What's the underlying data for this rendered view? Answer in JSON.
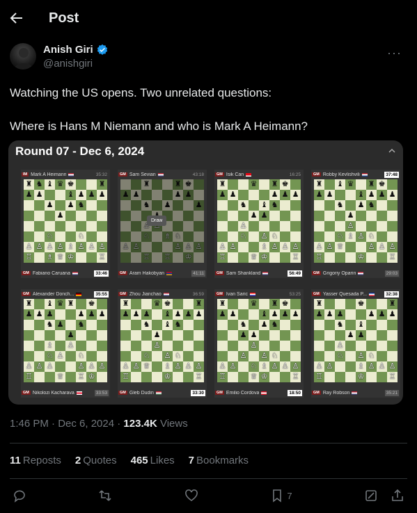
{
  "header": {
    "title": "Post"
  },
  "author": {
    "name": "Anish Giri",
    "handle": "@anishgiri"
  },
  "post": {
    "line1": "Watching the US opens. Two unrelated questions:",
    "line2": "Where is Hans M Niemann and who is Mark A Heimann?"
  },
  "media": {
    "title": "Round 07 - Dec 6, 2024",
    "draw_label": "Draw",
    "boards": [
      {
        "top": {
          "title": "IM",
          "name": "Mark A Heimann",
          "clock": "35:32",
          "flag": "us"
        },
        "bottom": {
          "title": "GM",
          "name": "Fabiano Caruana",
          "clock": "33:46",
          "flag": "us"
        },
        "fen": "rnbqk..r/pp..bppp/..p.pn../...p....//..N..N../PPPPBPPP/R.BQK..R"
      },
      {
        "top": {
          "title": "GM",
          "name": "Sam Sevian",
          "clock": "43:18",
          "flag": "us"
        },
        "bottom": {
          "title": "GM",
          "name": "Aram Hakobyan",
          "clock": "41:11",
          "flag": "am"
        },
        "fen": "..r..rk./pp...pp./..n.p..p/...p..../..PP..../..N.BN../PP...PPP/..R.R.K."
      },
      {
        "top": {
          "title": "GM",
          "name": "Isik Can",
          "clock": "16:25",
          "flag": "tr"
        },
        "bottom": {
          "title": "GM",
          "name": "Sam Shankland",
          "clock": "56:49",
          "flag": "us"
        },
        "fen": "r..q.rk./pp...ppp/..n.bn../...pp.../..P...../..N.PN../PP..BPPP/R..QK..R"
      },
      {
        "top": {
          "title": "GM",
          "name": "Robby Kevlishvili",
          "clock": "37:48",
          "flag": "nl"
        },
        "bottom": {
          "title": "GM",
          "name": "Grigoriy Oparin",
          "clock": "29:03",
          "flag": "us"
        },
        "fen": "r.bq.rk./pp..bppp/..n.pn../...p..../...P..../..NBPN../PPQ..PPP/R...K..R"
      },
      {
        "top": {
          "title": "GM",
          "name": "Alexander Donch...",
          "clock": "35:55",
          "flag": "de"
        },
        "bottom": {
          "title": "GM",
          "name": "Nikolozi Kacharava",
          "clock": "33:53",
          "flag": "ge"
        },
        "fen": "r.bqr.k./ppp..ppp/..np.n../....p.../..B.P.../..NP.N../PPP..PPP/R..Q.RK."
      },
      {
        "top": {
          "title": "GM",
          "name": "Zhou Jianchao",
          "clock": "36:59",
          "flag": "us"
        },
        "bottom": {
          "title": "GM",
          "name": "Gleb Dudin",
          "clock": "33:30",
          "flag": "hu"
        },
        "fen": "r..qk..r/ppp.bppp/..n.bn../...p..../...P..../..N.PN../PPQ.BPPP/R...K..R"
      },
      {
        "top": {
          "title": "GM",
          "name": "Ivan Saric",
          "clock": "53:25",
          "flag": "hr"
        },
        "bottom": {
          "title": "GM",
          "name": "Emilio Cordova",
          "clock": "18:50",
          "flag": "pe"
        },
        "fen": "r..q.rk./pp..bppp/..n.pn../..pp..../...P..../..P.PN../PP.NBPPP/R..QK..R"
      },
      {
        "top": {
          "title": "GM",
          "name": "Yasser Quesada P...",
          "clock": "32:38",
          "flag": "cu"
        },
        "bottom": {
          "title": "GM",
          "name": "Ray Robson",
          "clock": "35:21",
          "flag": "us"
        },
        "fen": "r...k..r/ppp..ppp/..n.b.../...pp.../..P...../..N.PN../PP..BPPP/R...K..R"
      }
    ]
  },
  "meta": {
    "time": "1:46 PM · Dec 6, 2024 · ",
    "views_count": "123.4K",
    "views_label": " Views"
  },
  "stats": {
    "reposts_count": "11",
    "reposts_label": "Reposts",
    "quotes_count": "2",
    "quotes_label": "Quotes",
    "likes_count": "465",
    "likes_label": "Likes",
    "bookmarks_count": "7",
    "bookmarks_label": "Bookmarks"
  },
  "actions": {
    "bookmark_count": "7"
  },
  "colors": {
    "accent": "#1d9bf0",
    "light_square": "#ebecd0",
    "dark_square": "#739552"
  }
}
